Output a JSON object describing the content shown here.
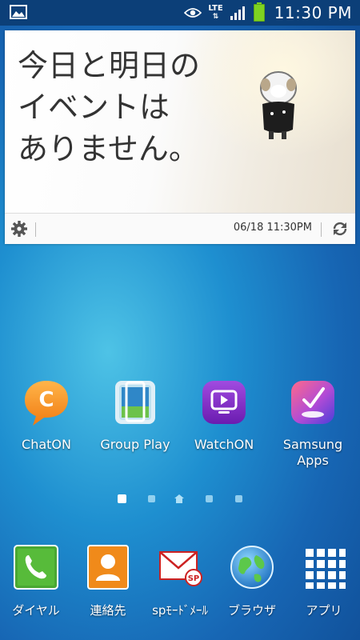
{
  "status_bar": {
    "network_label": "LTE",
    "network_arrows": "⇅",
    "time": "11:30 PM",
    "battery_color": "#7ed321",
    "icons": [
      "image-icon",
      "eye-icon",
      "signal-icon",
      "battery-icon"
    ]
  },
  "widget": {
    "message_lines": [
      "今日と明日の",
      "イベントは",
      "ありません。"
    ],
    "timestamp": "06/18 11:30PM",
    "icons": [
      "gear-icon",
      "refresh-icon"
    ]
  },
  "apps": [
    {
      "label": "ChatON",
      "icon": "chaton-icon"
    },
    {
      "label": "Group Play",
      "icon": "group-play-icon"
    },
    {
      "label": "WatchON",
      "icon": "watchon-icon"
    },
    {
      "label": "Samsung Apps",
      "icon": "samsung-apps-icon"
    }
  ],
  "pager": {
    "pages": 5,
    "active_index": 0,
    "home_index": 2
  },
  "dock": [
    {
      "label": "ダイヤル",
      "icon": "phone-icon"
    },
    {
      "label": "連絡先",
      "icon": "contacts-icon"
    },
    {
      "label": "spﾓｰﾄﾞﾒｰﾙ",
      "icon": "mail-icon"
    },
    {
      "label": "ブラウザ",
      "icon": "globe-icon"
    },
    {
      "label": "アプリ",
      "icon": "apps-grid-icon"
    }
  ]
}
